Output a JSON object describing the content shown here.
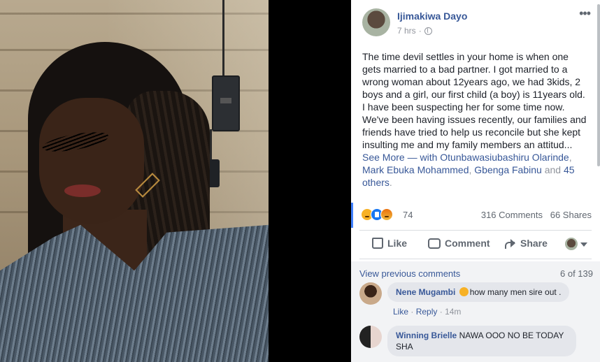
{
  "post": {
    "author": "Ijimakiwa Dayo",
    "timestamp": "7 hrs",
    "separator": "·",
    "more_glyph": "•••",
    "body": "The time devil settles in your home is when one gets married to a bad partner. I got married to a wrong woman about 12years ago, we had 3kids, 2 boys and a girl, our first child (a boy) is 11years old. I have been suspecting her for some time now. We've been having issues recently, our families and friends have tried to help us reconcile but she kept insulting me and my family members an attitud...",
    "see_more": "See More",
    "with_prefix": "— with",
    "tags": [
      "Otunbawasiubashiru Olarinde",
      "Mark Ebuka Mohammed",
      "Gbenga Fabinu"
    ],
    "and_word": "and",
    "others": "45 others",
    "period": "."
  },
  "reactions": {
    "count": "74",
    "comments": "316 Comments",
    "shares": "66 Shares",
    "types": [
      "sad",
      "like",
      "angry"
    ]
  },
  "actions": {
    "like": "Like",
    "comment": "Comment",
    "share": "Share"
  },
  "comments": {
    "view_previous": "View previous comments",
    "count": "6 of 139",
    "items": [
      {
        "name": "Nene Mugambi",
        "text": "how many men sire out .",
        "emoji": "rolling-eyes",
        "like": "Like",
        "reply": "Reply",
        "time": "14m"
      },
      {
        "name": "Winning Brielle",
        "text": "NAWA OOO NO BE TODAY SHA"
      }
    ]
  },
  "colors": {
    "link": "#385898",
    "muted": "#90949c",
    "accent_bar": "#4080ff"
  }
}
